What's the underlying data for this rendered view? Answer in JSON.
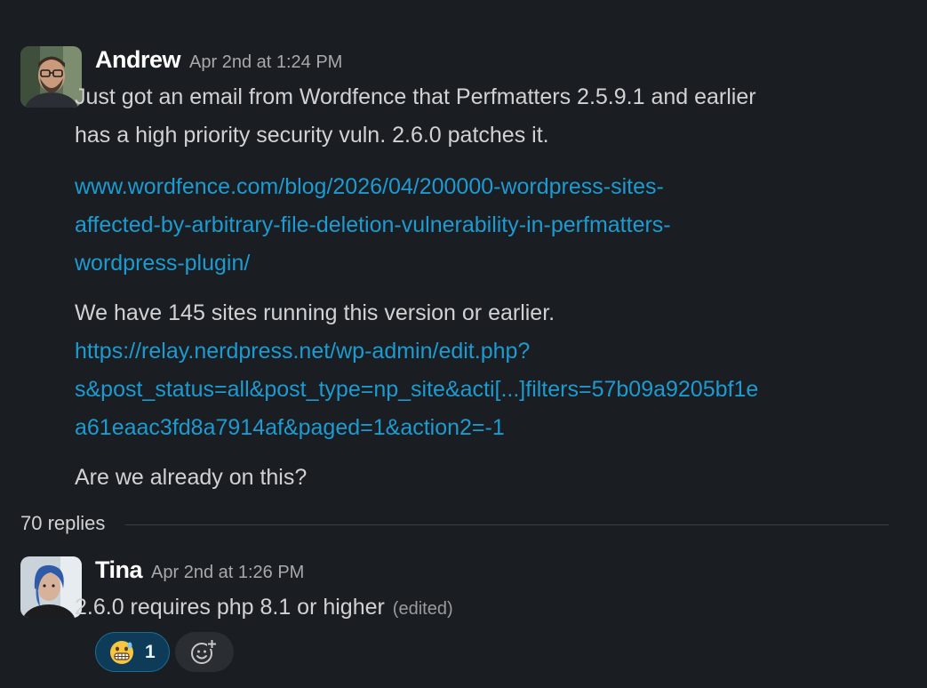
{
  "messages": [
    {
      "author": "Andrew",
      "time": "Apr 2nd at 1:24 PM",
      "para1_line1": "Just got an email from Wordfence that Perfmatters 2.5.9.1 and earlier",
      "para1_line2": "has a high priority security vuln.  2.6.0 patches it.",
      "link1_line1": "www.wordfence.com/blog/2026/04/200000-wordpress-sites-",
      "link1_line2": "affected-by-arbitrary-file-deletion-vulnerability-in-perfmatters-",
      "link1_line3": "wordpress-plugin/",
      "para2": "We have 145 sites running this version or earlier.",
      "link2_line1": "https://relay.nerdpress.net/wp-admin/edit.php?",
      "link2_line2": "s&post_status=all&post_type=np_site&acti[...]filters=57b09a9205bf1e",
      "link2_line3": "a61eaac3fd8a7914af&paged=1&action2=-1",
      "para3": "Are we already on this?"
    },
    {
      "author": "Tina",
      "time": "Apr 2nd at 1:26 PM",
      "text": "2.6.0 requires php 8.1 or higher",
      "edited": "(edited)"
    }
  ],
  "thread": {
    "replies_label": "70 replies"
  },
  "reactions": [
    {
      "emoji": "grimacing-face-emoji",
      "count": "1"
    }
  ],
  "icons": {
    "add_reaction": "add-reaction-icon"
  },
  "colors": {
    "background": "#1a1d21",
    "text": "#d1d2d3",
    "link": "#1d9bd1",
    "reaction_bg": "#0d3b58"
  }
}
